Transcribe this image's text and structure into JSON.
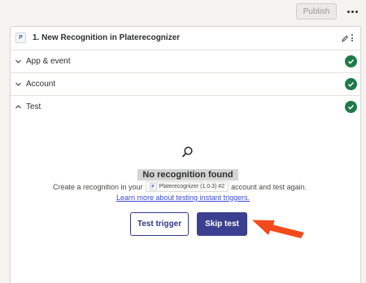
{
  "toolbar": {
    "publish_label": "Publish",
    "more_icon": "more-horizontal-icon"
  },
  "step": {
    "app_logo_letter": "P",
    "title": "1. New Recognition in Platerecognizer"
  },
  "sections": [
    {
      "label": "App & event",
      "status": "complete"
    },
    {
      "label": "Account",
      "status": "complete"
    },
    {
      "label": "Test",
      "status": "complete"
    }
  ],
  "empty_state": {
    "title": "No recognition found",
    "desc_prefix": "Create a recognition in your",
    "chip_logo_letter": "P",
    "chip_label": "Platerecognizer (1.0.3) #2",
    "desc_suffix": "account and test again.",
    "learn_more": "Learn more about testing instant triggers."
  },
  "actions": {
    "test_trigger": "Test trigger",
    "skip_test": "Skip test"
  },
  "colors": {
    "check_green": "#1f7a4a",
    "primary": "#3b3f8f",
    "link": "#3b4bd0",
    "annotation_arrow": "#f24a1c"
  }
}
